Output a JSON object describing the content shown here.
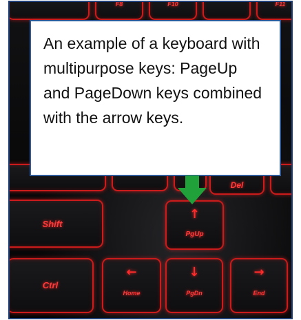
{
  "callout": {
    "text": "An example of a keyboard with multipurpose keys: PageUp and PageDown keys combined with the arrow keys."
  },
  "keys": {
    "shift": "Shift",
    "ctrl": "Ctrl",
    "del": "Del",
    "pgup": "PgUp",
    "pgdn": "PgDn",
    "home": "Home",
    "end": "End",
    "f_row_left": "F8",
    "f_row_mid": "F10",
    "f_row_right": "F11"
  },
  "icons": {
    "pointer": "green-down-arrow-icon",
    "up": "↑",
    "down": "↓",
    "left": "←",
    "right": "→"
  },
  "colors": {
    "backlight": "#ff2b2b",
    "pointer": "#21a13a",
    "callout_border": "#2e5a9a"
  }
}
